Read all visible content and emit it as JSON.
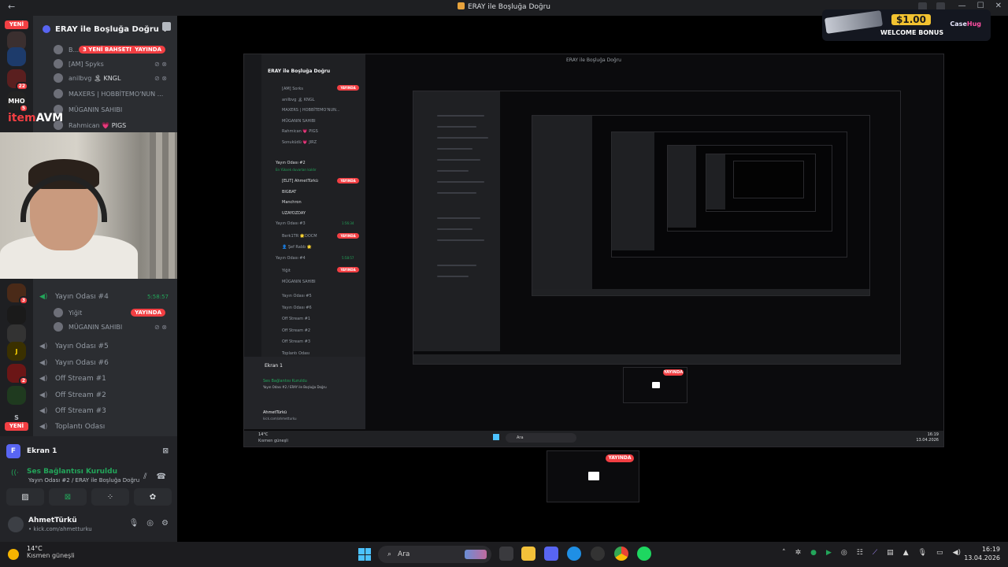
{
  "window": {
    "title": "ERAY ile Boşluğa Doğru"
  },
  "server": {
    "name": "ERAY ile Boşluğa Doğru ⌄"
  },
  "badges": {
    "new": "YENİ",
    "live": "YAYINDA",
    "new_talk": "3 YENİ BAHSETME"
  },
  "overlay_brand": {
    "prefix": "item",
    "suffix": "AVM"
  },
  "members_top": [
    {
      "name": "B..."
    },
    {
      "name": "[AM] Spyks"
    },
    {
      "name": "anilbvg",
      "tag": "🏝 KNGL"
    },
    {
      "name": "MAXERS | HOBBİTEMO'NUN ..."
    },
    {
      "name": "MÜGANIN SAHIBI"
    },
    {
      "name": "Rahmican",
      "tag": "💗 PIGS"
    }
  ],
  "voice_channels": [
    {
      "name": "Yayın Odası #4",
      "timer": "5:58:57"
    },
    {
      "name": "Yayın Odası #5"
    },
    {
      "name": "Yayın Odası #6"
    },
    {
      "name": "Off Stream #1"
    },
    {
      "name": "Off Stream #2"
    },
    {
      "name": "Off Stream #3"
    },
    {
      "name": "Toplantı Odası"
    }
  ],
  "room4_members": [
    {
      "name": "Yiğit"
    },
    {
      "name": "MÜGANIN SAHIBI"
    }
  ],
  "guild_pings": [
    "22",
    "5",
    "3",
    "2"
  ],
  "guild_labels": {
    "mho": "MHO",
    "s": "S"
  },
  "screen_share": {
    "title": "Ekran 1",
    "icon_letter": "F"
  },
  "voice": {
    "status": "Ses Bağlantısı Kuruldu",
    "location": "Yayın Odası #2 / ERAY ile Boşluğa Doğru"
  },
  "user": {
    "name": "AhmetTürkü",
    "status": "• kick.com/ahmetturku"
  },
  "promo": {
    "amount": "$1.00",
    "label": "WELCOME BONUS",
    "brand_a": "Case",
    "brand_b": "Hug"
  },
  "taskbar": {
    "temp": "14°C",
    "weather": "Kısmen güneşli",
    "search_placeholder": "Ara",
    "time": "16:19",
    "date": "13.04.2026"
  },
  "nested": {
    "l1": {
      "server": "ERAY ile Boşluğa Doğru",
      "members": [
        "[AM] Sorks",
        "anilbvg 🏝 KNGL",
        "MAXERS | HOBBİTEMO'NUN...",
        "MÜGANIN SAHIBI",
        "Rahmican 💗 PIGS",
        "Sonuküdü 💗 JIRZ"
      ],
      "room2": "Yayın Odası #2",
      "room2_sub": "En Yüksek duvarları kaldır",
      "room2_members": [
        "[ELIT] AhmetTürkü",
        "BIGBAT",
        "Manchron",
        "UZAYOZDAY"
      ],
      "room3": "Yayın Odası #3",
      "room3_timer": "1:56:34",
      "room3_members": [
        "Berk1TR 🌟DOCM",
        "👤 Şef Rabb 🌟"
      ],
      "room4": "Yayın Odası #4",
      "room4_timer": "5:58:57",
      "room4_members": [
        "Yiğit",
        "MÜGANIN SAHIBI"
      ],
      "other_rooms": [
        "Yayın Odası #5",
        "Yayın Odası #6",
        "Off Stream #1",
        "Off Stream #2",
        "Off Stream #3",
        "Toplantı Odası"
      ],
      "panel_title": "Ekran 1",
      "voice_status": "Ses Bağlantısı Kuruldu",
      "voice_loc": "Yayın Odası #2 / ERAY ile Boşluğa Doğru",
      "user": "AhmetTürkü",
      "user_status": "kick.com/ahmetturku",
      "temp": "14°C",
      "weather": "Kısmen güneşli",
      "search": "Ara",
      "time": "16:19",
      "date": "13.04.2026"
    }
  }
}
